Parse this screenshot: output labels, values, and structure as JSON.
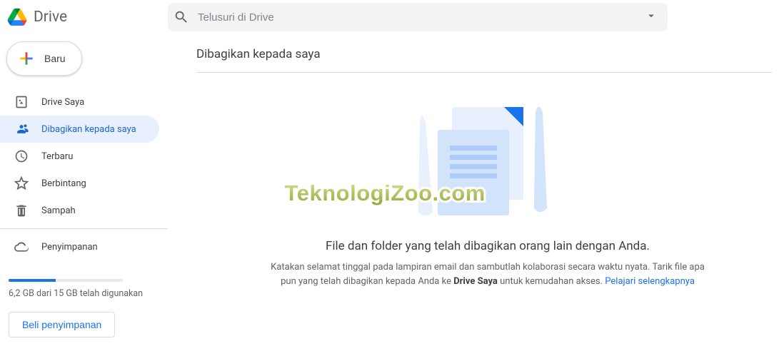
{
  "app_name": "Drive",
  "search": {
    "placeholder": "Telusuri di Drive"
  },
  "sidebar": {
    "new_label": "Baru",
    "items": [
      {
        "label": "Drive Saya",
        "icon": "drive-icon"
      },
      {
        "label": "Dibagikan kepada saya",
        "icon": "shared-icon",
        "active": true
      },
      {
        "label": "Terbaru",
        "icon": "clock-icon"
      },
      {
        "label": "Berbintang",
        "icon": "star-icon"
      },
      {
        "label": "Sampah",
        "icon": "trash-icon"
      }
    ],
    "storage_label": "Penyimpanan",
    "storage_used_text": "6,2 GB dari 15 GB telah digunakan",
    "storage_percent": 41,
    "buy_label": "Beli penyimpanan"
  },
  "content": {
    "title": "Dibagikan kepada saya",
    "empty_heading": "File dan folder yang telah dibagikan orang lain dengan Anda.",
    "empty_sub_1": "Katakan selamat tinggal pada lampiran email dan sambutlah kolaborasi secara waktu nyata. Tarik file apa pun yang telah dibagikan kepada Anda ke ",
    "empty_bold": "Drive Saya",
    "empty_sub_2": " untuk kemudahan akses. ",
    "learn_more": "Pelajari selengkapnya"
  },
  "watermark": "TeknologiZoo.com"
}
